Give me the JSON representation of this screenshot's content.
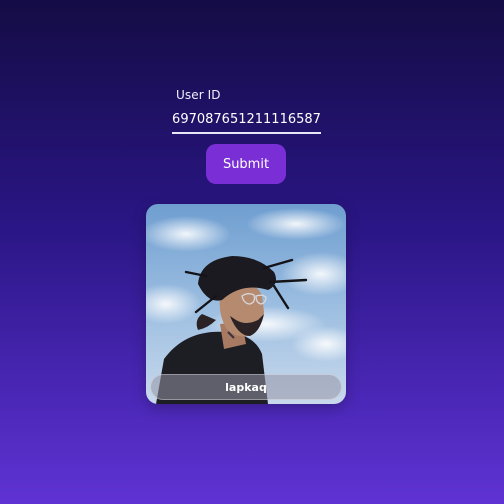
{
  "form": {
    "label": "User ID",
    "value": "697087651211116587",
    "submit_label": "Submit"
  },
  "profile": {
    "username": "lapkaq",
    "avatar_description_icon": "profile-photo"
  },
  "colors": {
    "background_top": "#140c45",
    "background_bottom": "#5f33d3",
    "button": "#7a2fd6",
    "input_underline": "#e9e6f5"
  }
}
